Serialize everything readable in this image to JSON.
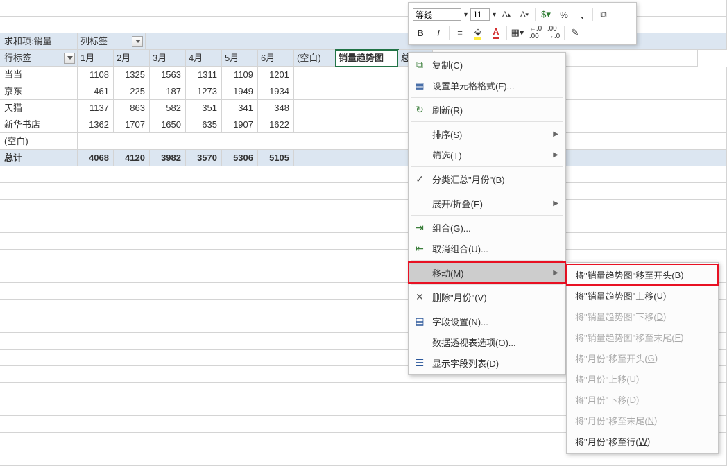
{
  "pivot": {
    "title": "求和项:销量",
    "colLabel": "列标签",
    "rowLabel": "行标签",
    "months": [
      "1月",
      "2月",
      "3月",
      "4月",
      "5月",
      "6月"
    ],
    "blank": "(空白)",
    "trend": "销量趋势图",
    "total": "总计",
    "rows": [
      {
        "name": "当当",
        "v": [
          1108,
          1325,
          1563,
          1311,
          1109,
          1201
        ]
      },
      {
        "name": "京东",
        "v": [
          461,
          225,
          187,
          1273,
          1949,
          1934
        ]
      },
      {
        "name": "天猫",
        "v": [
          1137,
          863,
          582,
          351,
          341,
          348
        ]
      },
      {
        "name": "新华书店",
        "v": [
          1362,
          1707,
          1650,
          635,
          1907,
          1622
        ]
      }
    ],
    "blankRow": "(空白)",
    "totals": [
      4068,
      4120,
      3982,
      3570,
      5306,
      5105
    ]
  },
  "toolbar": {
    "font": "等线",
    "size": "11",
    "grow": "A▴",
    "shrink": "A▾",
    "bold": "B",
    "italic": "I",
    "align": "≡",
    "pct": "%",
    "comma": ",",
    "incDec": ".00",
    "decDec": ".0"
  },
  "menu": {
    "copy": "复制(C)",
    "fmt": "设置单元格格式(F)...",
    "refresh": "刷新(R)",
    "sort": "排序(S)",
    "filter": "筛选(T)",
    "subtotal_a": "分类汇总\"月份\"(",
    "subtotal_u": "B",
    "subtotal_b": ")",
    "expand": "展开/折叠(E)",
    "group": "组合(G)...",
    "ungroup": "取消组合(U)...",
    "move": "移动(M)",
    "delete": "删除\"月份\"(V)",
    "field": "字段设置(N)...",
    "options": "数据透视表选项(O)...",
    "list": "显示字段列表(D)"
  },
  "submenu": [
    {
      "t": "将\"销量趋势图\"移至开头(B)",
      "en": true,
      "red": true,
      "u": "B"
    },
    {
      "t": "将\"销量趋势图\"上移(U)",
      "en": true,
      "u": "U"
    },
    {
      "t": "将\"销量趋势图\"下移(D)",
      "en": false,
      "u": "D"
    },
    {
      "t": "将\"销量趋势图\"移至末尾(E)",
      "en": false,
      "u": "E"
    },
    {
      "t": "将\"月份\"移至开头(G)",
      "en": false,
      "u": "G"
    },
    {
      "t": "将\"月份\"上移(U)",
      "en": false,
      "u": "U"
    },
    {
      "t": "将\"月份\"下移(D)",
      "en": false,
      "u": "D"
    },
    {
      "t": "将\"月份\"移至末尾(N)",
      "en": false,
      "u": "N"
    },
    {
      "t": "将\"月份\"移至行(W)",
      "en": true,
      "u": "W"
    }
  ]
}
